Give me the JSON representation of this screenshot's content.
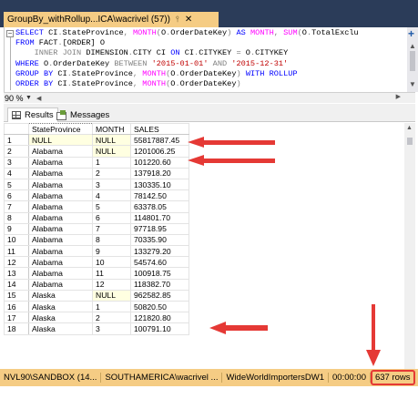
{
  "tab": {
    "title": "GroupBy_withRollup...ICA\\wacrivel (57))",
    "pin_icon": "pin-icon",
    "close_icon": "close-icon"
  },
  "editor": {
    "lines": [
      [
        {
          "t": "SELECT ",
          "c": "kw"
        },
        {
          "t": "CI",
          "c": ""
        },
        {
          "t": ".",
          "c": "op"
        },
        {
          "t": "StateProvince",
          "c": ""
        },
        {
          "t": ", ",
          "c": "op"
        },
        {
          "t": "MONTH",
          "c": "fn"
        },
        {
          "t": "(",
          "c": "op"
        },
        {
          "t": "O",
          "c": ""
        },
        {
          "t": ".",
          "c": "op"
        },
        {
          "t": "OrderDateKey",
          "c": ""
        },
        {
          "t": ") ",
          "c": "op"
        },
        {
          "t": "AS ",
          "c": "kw"
        },
        {
          "t": "MONTH",
          "c": "fn"
        },
        {
          "t": ", ",
          "c": "op"
        },
        {
          "t": "SUM",
          "c": "fn"
        },
        {
          "t": "(",
          "c": "op"
        },
        {
          "t": "O",
          "c": ""
        },
        {
          "t": ".",
          "c": "op"
        },
        {
          "t": "TotalExclu",
          "c": ""
        }
      ],
      [
        {
          "t": "FROM ",
          "c": "kw"
        },
        {
          "t": "FACT",
          "c": ""
        },
        {
          "t": ".",
          "c": "op"
        },
        {
          "t": "[ORDER] O",
          "c": ""
        }
      ],
      [
        {
          "t": "    INNER JOIN ",
          "c": "op"
        },
        {
          "t": "DIMENSION",
          "c": ""
        },
        {
          "t": ".",
          "c": "op"
        },
        {
          "t": "CITY CI ",
          "c": ""
        },
        {
          "t": "ON ",
          "c": "kw"
        },
        {
          "t": "CI",
          "c": ""
        },
        {
          "t": ".",
          "c": "op"
        },
        {
          "t": "CITYKEY ",
          "c": ""
        },
        {
          "t": "= ",
          "c": "op"
        },
        {
          "t": "O",
          "c": ""
        },
        {
          "t": ".",
          "c": "op"
        },
        {
          "t": "CITYKEY",
          "c": ""
        }
      ],
      [
        {
          "t": "WHERE ",
          "c": "kw"
        },
        {
          "t": "O",
          "c": ""
        },
        {
          "t": ".",
          "c": "op"
        },
        {
          "t": "OrderDateKey ",
          "c": ""
        },
        {
          "t": "BETWEEN ",
          "c": "op"
        },
        {
          "t": "'2015-01-01' ",
          "c": "str"
        },
        {
          "t": "AND ",
          "c": "op"
        },
        {
          "t": "'2015-12-31'",
          "c": "str"
        }
      ],
      [
        {
          "t": "GROUP BY ",
          "c": "kw"
        },
        {
          "t": "CI",
          "c": ""
        },
        {
          "t": ".",
          "c": "op"
        },
        {
          "t": "StateProvince",
          "c": ""
        },
        {
          "t": ", ",
          "c": "op"
        },
        {
          "t": "MONTH",
          "c": "fn"
        },
        {
          "t": "(",
          "c": "op"
        },
        {
          "t": "O",
          "c": ""
        },
        {
          "t": ".",
          "c": "op"
        },
        {
          "t": "OrderDateKey",
          "c": ""
        },
        {
          "t": ") ",
          "c": "op"
        },
        {
          "t": "WITH ROLLUP",
          "c": "kw"
        }
      ],
      [
        {
          "t": "ORDER BY ",
          "c": "kw"
        },
        {
          "t": "CI",
          "c": ""
        },
        {
          "t": ".",
          "c": "op"
        },
        {
          "t": "StateProvince",
          "c": ""
        },
        {
          "t": ", ",
          "c": "op"
        },
        {
          "t": "MONTH",
          "c": "fn"
        },
        {
          "t": "(",
          "c": "op"
        },
        {
          "t": "O",
          "c": ""
        },
        {
          "t": ".",
          "c": "op"
        },
        {
          "t": "OrderDateKey",
          "c": ""
        },
        {
          "t": ")",
          "c": "op"
        }
      ]
    ]
  },
  "zoom": {
    "value": "90 %"
  },
  "results_tabs": {
    "results_label": "Results",
    "messages_label": "Messages"
  },
  "grid": {
    "columns": [
      "StateProvince",
      "MONTH",
      "SALES"
    ],
    "rows": [
      [
        "1",
        "NULL",
        "NULL",
        "55817887.45"
      ],
      [
        "2",
        "Alabama",
        "NULL",
        "1201006.25"
      ],
      [
        "3",
        "Alabama",
        "1",
        "101220.60"
      ],
      [
        "4",
        "Alabama",
        "2",
        "137918.20"
      ],
      [
        "5",
        "Alabama",
        "3",
        "130335.10"
      ],
      [
        "6",
        "Alabama",
        "4",
        "78142.50"
      ],
      [
        "7",
        "Alabama",
        "5",
        "63378.05"
      ],
      [
        "8",
        "Alabama",
        "6",
        "114801.70"
      ],
      [
        "9",
        "Alabama",
        "7",
        "97718.95"
      ],
      [
        "10",
        "Alabama",
        "8",
        "70335.90"
      ],
      [
        "11",
        "Alabama",
        "9",
        "133279.20"
      ],
      [
        "12",
        "Alabama",
        "10",
        "54574.60"
      ],
      [
        "13",
        "Alabama",
        "11",
        "100918.75"
      ],
      [
        "14",
        "Alabama",
        "12",
        "118382.70"
      ],
      [
        "15",
        "Alaska",
        "NULL",
        "962582.85"
      ],
      [
        "16",
        "Alaska",
        "1",
        "50820.50"
      ],
      [
        "17",
        "Alaska",
        "2",
        "121820.80"
      ],
      [
        "18",
        "Alaska",
        "3",
        "100791.10"
      ]
    ]
  },
  "status": {
    "server": "NVL90\\SANDBOX (14...",
    "user": "SOUTHAMERICA\\wacrivel ...",
    "database": "WideWorldImportersDW1",
    "elapsed": "00:00:00",
    "rows": "637 rows"
  },
  "colors": {
    "tab_strip": "#2b3c59",
    "tab_active": "#f5cc84",
    "arrow": "#e53935",
    "null_cell": "#ffffe1"
  }
}
